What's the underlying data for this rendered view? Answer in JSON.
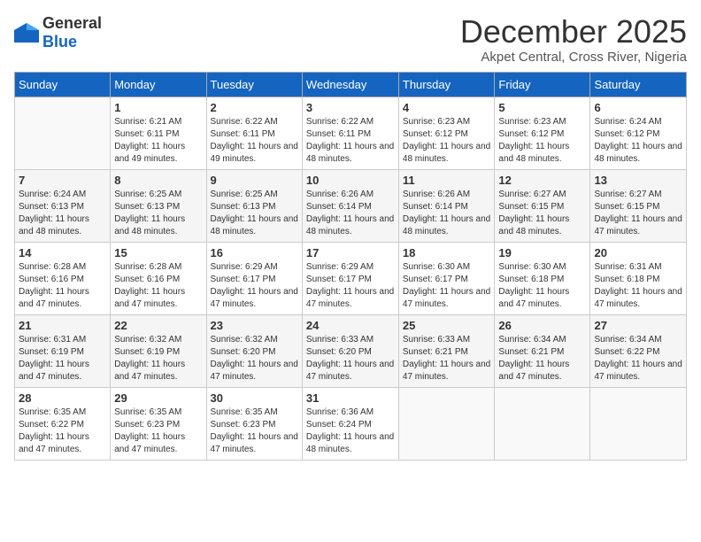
{
  "logo": {
    "general": "General",
    "blue": "Blue"
  },
  "title": "December 2025",
  "location": "Akpet Central, Cross River, Nigeria",
  "days_of_week": [
    "Sunday",
    "Monday",
    "Tuesday",
    "Wednesday",
    "Thursday",
    "Friday",
    "Saturday"
  ],
  "weeks": [
    [
      {
        "day": "",
        "sunrise": "",
        "sunset": "",
        "daylight": ""
      },
      {
        "day": "1",
        "sunrise": "Sunrise: 6:21 AM",
        "sunset": "Sunset: 6:11 PM",
        "daylight": "Daylight: 11 hours and 49 minutes."
      },
      {
        "day": "2",
        "sunrise": "Sunrise: 6:22 AM",
        "sunset": "Sunset: 6:11 PM",
        "daylight": "Daylight: 11 hours and 49 minutes."
      },
      {
        "day": "3",
        "sunrise": "Sunrise: 6:22 AM",
        "sunset": "Sunset: 6:11 PM",
        "daylight": "Daylight: 11 hours and 48 minutes."
      },
      {
        "day": "4",
        "sunrise": "Sunrise: 6:23 AM",
        "sunset": "Sunset: 6:12 PM",
        "daylight": "Daylight: 11 hours and 48 minutes."
      },
      {
        "day": "5",
        "sunrise": "Sunrise: 6:23 AM",
        "sunset": "Sunset: 6:12 PM",
        "daylight": "Daylight: 11 hours and 48 minutes."
      },
      {
        "day": "6",
        "sunrise": "Sunrise: 6:24 AM",
        "sunset": "Sunset: 6:12 PM",
        "daylight": "Daylight: 11 hours and 48 minutes."
      }
    ],
    [
      {
        "day": "7",
        "sunrise": "Sunrise: 6:24 AM",
        "sunset": "Sunset: 6:13 PM",
        "daylight": "Daylight: 11 hours and 48 minutes."
      },
      {
        "day": "8",
        "sunrise": "Sunrise: 6:25 AM",
        "sunset": "Sunset: 6:13 PM",
        "daylight": "Daylight: 11 hours and 48 minutes."
      },
      {
        "day": "9",
        "sunrise": "Sunrise: 6:25 AM",
        "sunset": "Sunset: 6:13 PM",
        "daylight": "Daylight: 11 hours and 48 minutes."
      },
      {
        "day": "10",
        "sunrise": "Sunrise: 6:26 AM",
        "sunset": "Sunset: 6:14 PM",
        "daylight": "Daylight: 11 hours and 48 minutes."
      },
      {
        "day": "11",
        "sunrise": "Sunrise: 6:26 AM",
        "sunset": "Sunset: 6:14 PM",
        "daylight": "Daylight: 11 hours and 48 minutes."
      },
      {
        "day": "12",
        "sunrise": "Sunrise: 6:27 AM",
        "sunset": "Sunset: 6:15 PM",
        "daylight": "Daylight: 11 hours and 48 minutes."
      },
      {
        "day": "13",
        "sunrise": "Sunrise: 6:27 AM",
        "sunset": "Sunset: 6:15 PM",
        "daylight": "Daylight: 11 hours and 47 minutes."
      }
    ],
    [
      {
        "day": "14",
        "sunrise": "Sunrise: 6:28 AM",
        "sunset": "Sunset: 6:16 PM",
        "daylight": "Daylight: 11 hours and 47 minutes."
      },
      {
        "day": "15",
        "sunrise": "Sunrise: 6:28 AM",
        "sunset": "Sunset: 6:16 PM",
        "daylight": "Daylight: 11 hours and 47 minutes."
      },
      {
        "day": "16",
        "sunrise": "Sunrise: 6:29 AM",
        "sunset": "Sunset: 6:17 PM",
        "daylight": "Daylight: 11 hours and 47 minutes."
      },
      {
        "day": "17",
        "sunrise": "Sunrise: 6:29 AM",
        "sunset": "Sunset: 6:17 PM",
        "daylight": "Daylight: 11 hours and 47 minutes."
      },
      {
        "day": "18",
        "sunrise": "Sunrise: 6:30 AM",
        "sunset": "Sunset: 6:17 PM",
        "daylight": "Daylight: 11 hours and 47 minutes."
      },
      {
        "day": "19",
        "sunrise": "Sunrise: 6:30 AM",
        "sunset": "Sunset: 6:18 PM",
        "daylight": "Daylight: 11 hours and 47 minutes."
      },
      {
        "day": "20",
        "sunrise": "Sunrise: 6:31 AM",
        "sunset": "Sunset: 6:18 PM",
        "daylight": "Daylight: 11 hours and 47 minutes."
      }
    ],
    [
      {
        "day": "21",
        "sunrise": "Sunrise: 6:31 AM",
        "sunset": "Sunset: 6:19 PM",
        "daylight": "Daylight: 11 hours and 47 minutes."
      },
      {
        "day": "22",
        "sunrise": "Sunrise: 6:32 AM",
        "sunset": "Sunset: 6:19 PM",
        "daylight": "Daylight: 11 hours and 47 minutes."
      },
      {
        "day": "23",
        "sunrise": "Sunrise: 6:32 AM",
        "sunset": "Sunset: 6:20 PM",
        "daylight": "Daylight: 11 hours and 47 minutes."
      },
      {
        "day": "24",
        "sunrise": "Sunrise: 6:33 AM",
        "sunset": "Sunset: 6:20 PM",
        "daylight": "Daylight: 11 hours and 47 minutes."
      },
      {
        "day": "25",
        "sunrise": "Sunrise: 6:33 AM",
        "sunset": "Sunset: 6:21 PM",
        "daylight": "Daylight: 11 hours and 47 minutes."
      },
      {
        "day": "26",
        "sunrise": "Sunrise: 6:34 AM",
        "sunset": "Sunset: 6:21 PM",
        "daylight": "Daylight: 11 hours and 47 minutes."
      },
      {
        "day": "27",
        "sunrise": "Sunrise: 6:34 AM",
        "sunset": "Sunset: 6:22 PM",
        "daylight": "Daylight: 11 hours and 47 minutes."
      }
    ],
    [
      {
        "day": "28",
        "sunrise": "Sunrise: 6:35 AM",
        "sunset": "Sunset: 6:22 PM",
        "daylight": "Daylight: 11 hours and 47 minutes."
      },
      {
        "day": "29",
        "sunrise": "Sunrise: 6:35 AM",
        "sunset": "Sunset: 6:23 PM",
        "daylight": "Daylight: 11 hours and 47 minutes."
      },
      {
        "day": "30",
        "sunrise": "Sunrise: 6:35 AM",
        "sunset": "Sunset: 6:23 PM",
        "daylight": "Daylight: 11 hours and 47 minutes."
      },
      {
        "day": "31",
        "sunrise": "Sunrise: 6:36 AM",
        "sunset": "Sunset: 6:24 PM",
        "daylight": "Daylight: 11 hours and 48 minutes."
      },
      {
        "day": "",
        "sunrise": "",
        "sunset": "",
        "daylight": ""
      },
      {
        "day": "",
        "sunrise": "",
        "sunset": "",
        "daylight": ""
      },
      {
        "day": "",
        "sunrise": "",
        "sunset": "",
        "daylight": ""
      }
    ]
  ]
}
